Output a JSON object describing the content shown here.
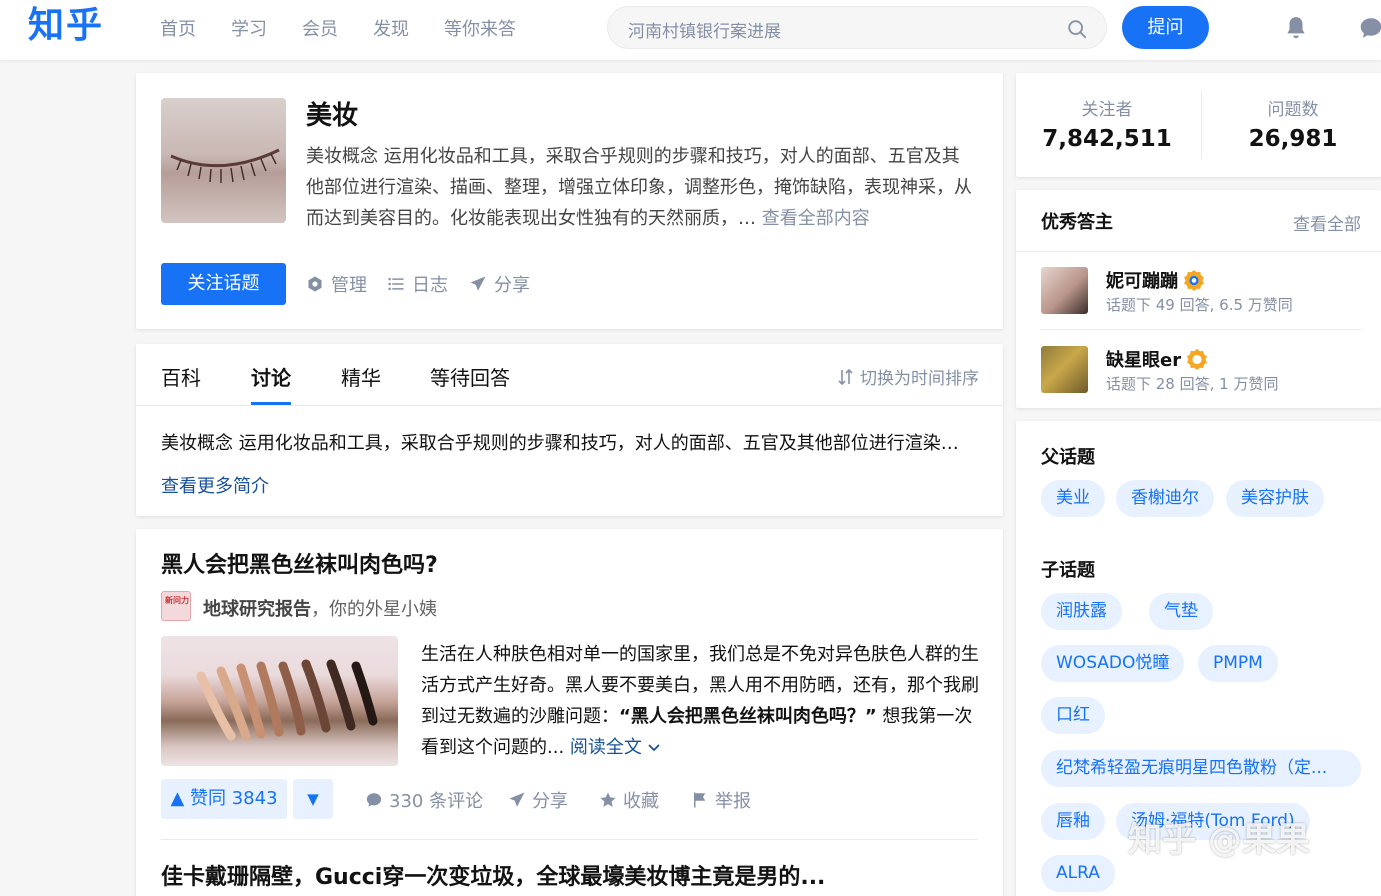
{
  "header": {
    "logo": "知乎",
    "nav": [
      "首页",
      "学习",
      "会员",
      "发现",
      "等你来答"
    ],
    "search_placeholder": "河南村镇银行案进展",
    "ask_label": "提问"
  },
  "topic": {
    "title": "美妆",
    "description": "美妆概念 运用化妆品和工具，采取合乎规则的步骤和技巧，对人的面部、五官及其他部位进行渲染、描画、整理，增强立体印象，调整形色，掩饰缺陷，表现神采，从而达到美容目的。化妆能表现出女性独有的天然丽质，…",
    "more_label": "查看全部内容",
    "follow_label": "关注话题",
    "actions": {
      "manage": "管理",
      "log": "日志",
      "share": "分享"
    }
  },
  "tabs": {
    "items": [
      "百科",
      "讨论",
      "精华",
      "等待回答"
    ],
    "active": "讨论",
    "sort_label": "切换为时间排序",
    "intro": "美妆概念 运用化妆品和工具，采取合乎规则的步骤和技巧，对人的面部、五官及其他部位进行渲染、描画、整理",
    "intro_more": "查看更多简介"
  },
  "feed": {
    "question": "黑人会把黑色丝袜叫肉色吗?",
    "author_avatar_text": "新问力",
    "author": "地球研究报告",
    "author_bio": "，你的外星小姨",
    "excerpt_pre": "生活在人种肤色相对单一的国家里，我们总是不免对异色肤色人群的生活方式产生好奇。黑人要不要美白，黑人用不用防晒，还有，那个我刷到过无数遍的沙雕问题：",
    "excerpt_highlight": "“黑人会把黑色丝袜叫肉色吗？”",
    "excerpt_post": " 想我第一次看到这个问题的...",
    "read_more": "阅读全文",
    "vote_label": "▲ 赞同 3843",
    "down_label": "▼",
    "comments": "330 条评论",
    "share": "分享",
    "favorite": "收藏",
    "report": "举报",
    "next_question": "佳卡戴珊隔壁，Gucci穿一次变垃圾，全球最壕美妆博主竟是男的..."
  },
  "stats": {
    "followers_label": "关注者",
    "followers": "7,842,511",
    "questions_label": "问题数",
    "questions": "26,981"
  },
  "experts": {
    "title": "优秀答主",
    "view_all": "查看全部",
    "list": [
      {
        "name": "妮可蹦蹦",
        "meta": "话题下 49 回答, 6.5 万赞同"
      },
      {
        "name": "缺星眼er",
        "meta": "话题下 28 回答, 1 万赞同"
      }
    ]
  },
  "parent_topics": {
    "title": "父话题",
    "items": [
      "美业",
      "香榭迪尔",
      "美容护肤"
    ]
  },
  "child_topics": {
    "title": "子话题",
    "items": [
      "润肤露",
      "气垫",
      "WOSADO悦瞳",
      "PMPM",
      "口红",
      "纪梵希轻盈无痕明星四色散粉（定...",
      "唇釉",
      "汤姆·福特(Tom Ford)",
      "ALRA"
    ]
  },
  "watermark": "知乎 @果果",
  "colors": {
    "brand": "#1772f6",
    "chip_bg": "#e7f1ff",
    "muted": "#8590a6",
    "link": "#175199"
  }
}
